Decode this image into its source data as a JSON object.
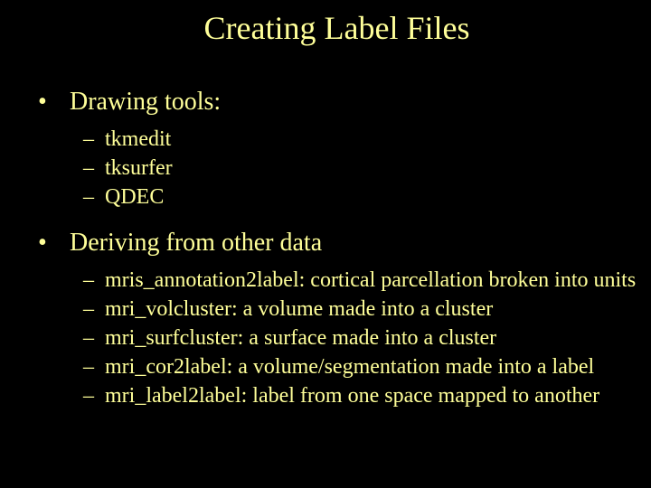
{
  "title": "Creating Label Files",
  "sections": [
    {
      "heading": "Drawing tools:",
      "items": [
        "tkmedit",
        "tksurfer",
        "QDEC"
      ]
    },
    {
      "heading": "Deriving from other data",
      "items": [
        "mris_annotation2label:  cortical parcellation broken into units",
        "mri_volcluster:  a volume made into a cluster",
        "mri_surfcluster:  a surface made into a cluster",
        "mri_cor2label:  a volume/segmentation made into a label",
        "mri_label2label:  label from one space mapped to another"
      ]
    }
  ]
}
